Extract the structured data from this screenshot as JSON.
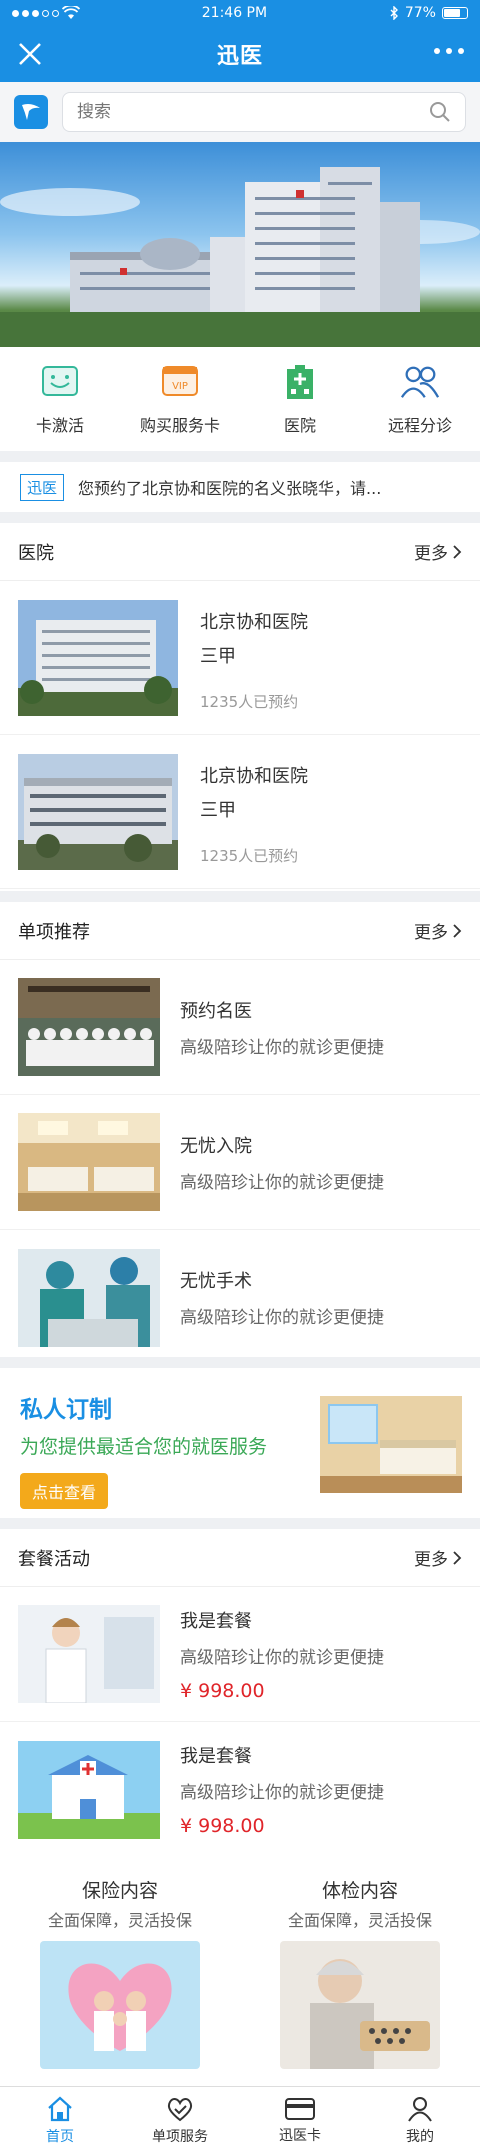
{
  "status": {
    "time": "21:46 PM",
    "battery": "77%"
  },
  "nav": {
    "title": "迅医"
  },
  "search": {
    "placeholder": "搜索"
  },
  "quick_menu": [
    {
      "label": "卡激活",
      "icon": "card-activate-icon"
    },
    {
      "label": "购买服务卡",
      "icon": "vip-card-icon"
    },
    {
      "label": "医院",
      "icon": "hospital-icon"
    },
    {
      "label": "远程分诊",
      "icon": "remote-triage-icon"
    }
  ],
  "notice": {
    "tag": "迅医",
    "text": "您预约了北京协和医院的名义张晓华，请..."
  },
  "hospitals": {
    "title": "医院",
    "more": "更多",
    "items": [
      {
        "name": "北京协和医院",
        "grade": "三甲",
        "count": "1235人已预约"
      },
      {
        "name": "北京协和医院",
        "grade": "三甲",
        "count": "1235人已预约"
      }
    ]
  },
  "recommend": {
    "title": "单项推荐",
    "more": "更多",
    "items": [
      {
        "title": "预约名医",
        "desc": "高级陪珍让你的就诊更便捷"
      },
      {
        "title": "无忧入院",
        "desc": "高级陪珍让你的就诊更便捷"
      },
      {
        "title": "无忧手术",
        "desc": "高级陪珍让你的就诊更便捷"
      }
    ]
  },
  "promo": {
    "title": "私人订制",
    "subtitle": "为您提供最适合您的就医服务",
    "button": "点击查看"
  },
  "packages": {
    "title": "套餐活动",
    "more": "更多",
    "items": [
      {
        "title": "我是套餐",
        "desc": "高级陪珍让你的就诊更便捷",
        "price": "¥ 998.00"
      },
      {
        "title": "我是套餐",
        "desc": "高级陪珍让你的就诊更便捷",
        "price": "¥ 998.00"
      }
    ]
  },
  "dual": [
    {
      "title": "保险内容",
      "subtitle": "全面保障，灵活投保"
    },
    {
      "title": "体检内容",
      "subtitle": "全面保障，灵活投保"
    }
  ],
  "tabbar": [
    {
      "label": "首页",
      "icon": "home-icon",
      "active": true
    },
    {
      "label": "单项服务",
      "icon": "heart-check-icon",
      "active": false
    },
    {
      "label": "迅医卡",
      "icon": "card-icon",
      "active": false
    },
    {
      "label": "我的",
      "icon": "user-icon",
      "active": false
    }
  ],
  "colors": {
    "primary": "#1a8fe3",
    "price": "#e0252a",
    "accent_green": "#3aa856",
    "button_orange": "#f3a91b"
  }
}
